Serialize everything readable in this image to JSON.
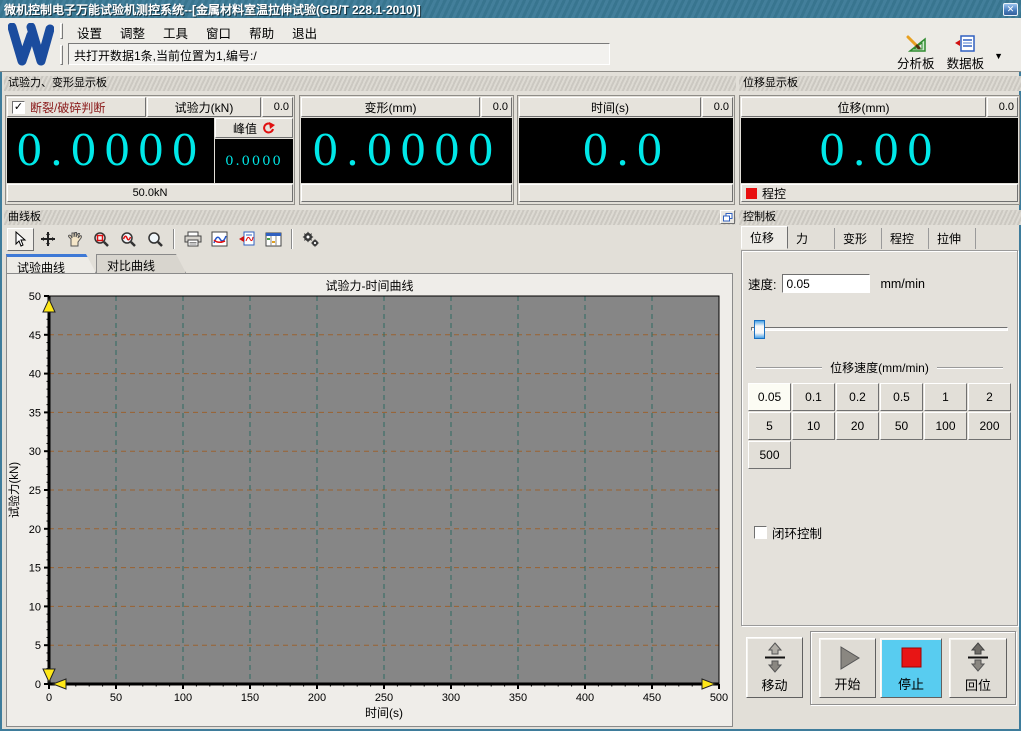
{
  "window": {
    "title": "微机控制电子万能试验机测控系统--[金属材料室温拉伸试验(GB/T 228.1-2010)]",
    "close_glyph": "✕"
  },
  "menu": {
    "items": [
      "设置",
      "调整",
      "工具",
      "窗口",
      "帮助",
      "退出"
    ]
  },
  "status": {
    "text": "共打开数据1条,当前位置为1,编号:/"
  },
  "top_tools": {
    "analysis": "分析板",
    "data": "数据板"
  },
  "display": {
    "section_title": "试验力、变形显示板",
    "force": {
      "break_label": "断裂/破碎判断",
      "break_checked": true,
      "name": "试验力(kN)",
      "aux": "0.0",
      "value": "0.0000",
      "peak_label": "峰值",
      "peak_value": "0.0000",
      "range": "50.0kN"
    },
    "deform": {
      "name": "变形(mm)",
      "aux": "0.0",
      "value": "0.0000"
    },
    "time": {
      "name": "时间(s)",
      "aux": "0.0",
      "value": "0.0"
    }
  },
  "displacement": {
    "section_title": "位移显示板",
    "name": "位移(mm)",
    "aux": "0.0",
    "value": "0.00",
    "status_label": "程控"
  },
  "curve": {
    "section_title": "曲线板",
    "tabs": [
      "试验曲线",
      "对比曲线"
    ],
    "active_tab": "试验曲线",
    "toolbar_icons": [
      "select-cursor",
      "crosshair-move",
      "pan-hand",
      "zoom-region",
      "zoom-curve",
      "zoom-reset",
      "print",
      "curve-style",
      "curve-export",
      "data-grid",
      "gears"
    ]
  },
  "chart_data": {
    "type": "line",
    "title": "试验力-时间曲线",
    "xlabel": "时间(s)",
    "ylabel": "试验力(kN)",
    "xlim": [
      0,
      500
    ],
    "ylim": [
      0,
      50
    ],
    "x_ticks": [
      0,
      50,
      100,
      150,
      200,
      250,
      300,
      350,
      400,
      450,
      500
    ],
    "y_ticks": [
      0,
      5,
      10,
      15,
      20,
      25,
      30,
      35,
      40,
      45,
      50
    ],
    "x_minor_step": 10,
    "y_minor_step": 1,
    "grid": true,
    "legend": "none",
    "series": [],
    "plot_bg": "#868686",
    "grid_color_h": "#9A6230",
    "grid_color_v": "#2F6B62",
    "marker_color": "#FFE818"
  },
  "control": {
    "section_title": "控制板",
    "tabs": [
      "位移",
      "力",
      "变形",
      "程控",
      "拉伸"
    ],
    "active_tab": "位移",
    "speed_label": "速度:",
    "speed_value": "0.05",
    "speed_unit": "mm/min",
    "group_title": "位移速度(mm/min)",
    "speed_presets": [
      "0.05",
      "0.1",
      "0.2",
      "0.5",
      "1",
      "2",
      "5",
      "10",
      "20",
      "50",
      "100",
      "200",
      "500"
    ],
    "active_preset": "0.05",
    "closed_loop_label": "闭环控制",
    "closed_loop_checked": false,
    "actions": {
      "move": "移动",
      "start": "开始",
      "stop": "停止",
      "reset": "回位"
    }
  },
  "colors": {
    "titlebar": "#3E7C9B",
    "lcd_digits": "#00E8E8",
    "stop_button_bg": "#58CCF0",
    "stop_square": "#E81515",
    "break_text": "#8B1A1A",
    "tab_accent": "#3E79D6"
  }
}
